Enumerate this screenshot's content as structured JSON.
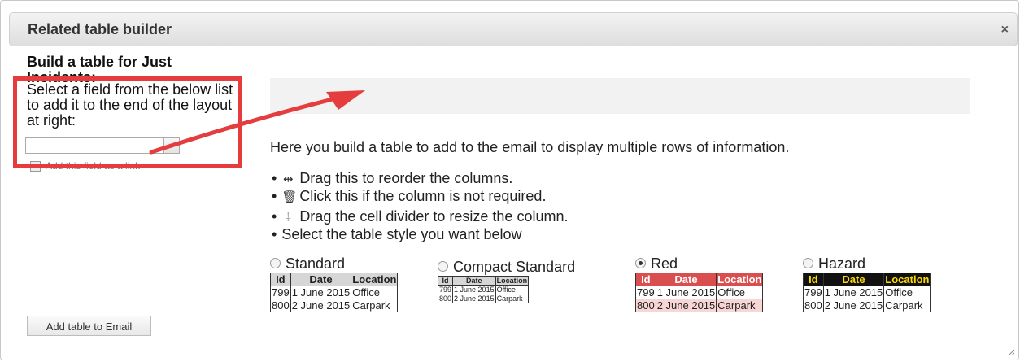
{
  "dialog": {
    "title": "Related table builder",
    "close_symbol": "×"
  },
  "left": {
    "heading": "Build a table for Just Incidents:",
    "instruction": "Select a field from the below list to add it to the end of the layout at right:",
    "select_value": "",
    "checkbox_label": "Add this field as a link",
    "add_button": "Add table to Email"
  },
  "main": {
    "description": "Here you build a table to add to the email to display multiple rows of information.",
    "bullets": [
      {
        "icon": "reorder-icon",
        "text": "Drag this to reorder the columns."
      },
      {
        "icon": "trash-icon",
        "text": "Click this if the column is not required."
      },
      {
        "icon": "resize-divider-icon",
        "text": "Drag the cell divider to resize the column."
      },
      {
        "icon": "",
        "text": "Select the table style you want below"
      }
    ],
    "bullet_char": "•",
    "styles": [
      {
        "label": "Standard",
        "selected": false
      },
      {
        "label": "Compact Standard",
        "selected": false
      },
      {
        "label": "Red",
        "selected": true
      },
      {
        "label": "Hazard",
        "selected": false
      }
    ],
    "preview": {
      "headers": [
        "Id",
        "Date",
        "Location"
      ],
      "rows": [
        [
          "799",
          "1 June 2015",
          "Office"
        ],
        [
          "800",
          "2 June 2015",
          "Carpark"
        ]
      ]
    }
  },
  "colors": {
    "highlight_annotation": "#e53d3d",
    "red_header": "#d94e4e",
    "hazard_header_bg": "#111111",
    "hazard_header_text": "#ffd900"
  }
}
